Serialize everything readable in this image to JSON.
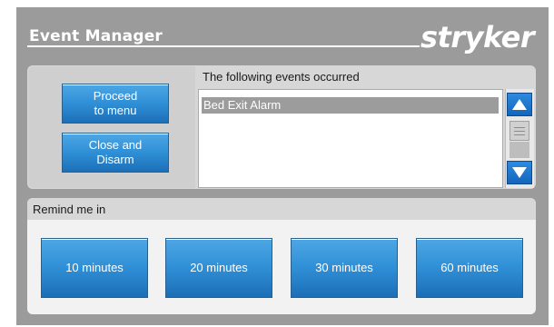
{
  "header": {
    "title": "Event Manager",
    "logo_text": "stryker"
  },
  "actions": {
    "proceed_label_line1": "Proceed",
    "proceed_label_line2": "to menu",
    "close_label_line1": "Close and",
    "close_label_line2": "Disarm"
  },
  "events": {
    "header": "The following events occurred",
    "items": [
      "Bed Exit Alarm"
    ]
  },
  "reminder": {
    "header": "Remind me in",
    "options": [
      "10 minutes",
      "20 minutes",
      "30 minutes",
      "60 minutes"
    ]
  },
  "colors": {
    "accent_blue": "#2f8fd6",
    "frame_gray": "#9b9b9b"
  },
  "icons": {
    "scroll_up": "triangle-up-icon",
    "scroll_down": "triangle-down-icon",
    "scroll_thumb": "grip-icon"
  }
}
